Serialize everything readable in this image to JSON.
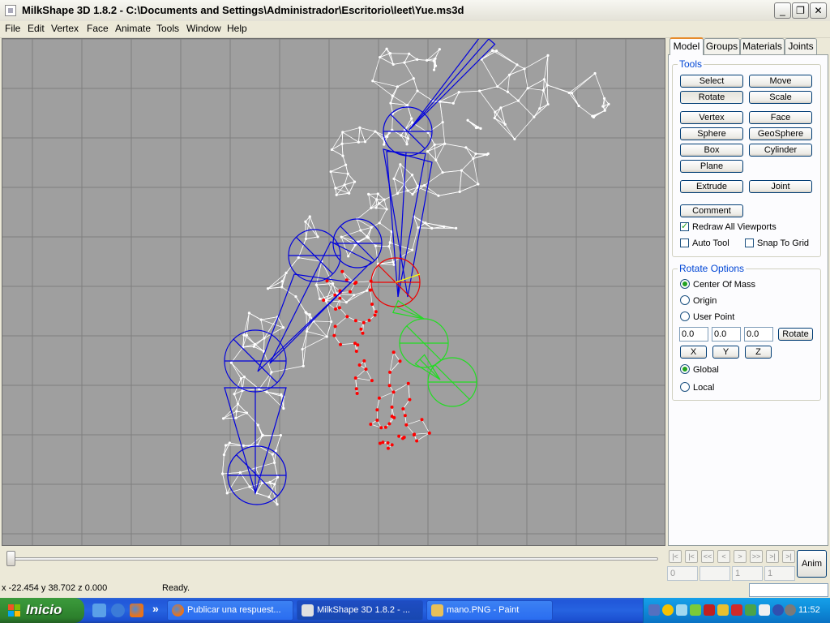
{
  "window": {
    "title": "MilkShape 3D 1.8.2 - C:\\Documents and Settings\\Administrador\\Escritorio\\leet\\Yue.ms3d",
    "minimize": "_",
    "maximize": "❐",
    "close": "✕"
  },
  "menu": [
    "File",
    "Edit",
    "Vertex",
    "Face",
    "Animate",
    "Tools",
    "Window",
    "Help"
  ],
  "tabs": [
    "Model",
    "Groups",
    "Materials",
    "Joints"
  ],
  "tools": {
    "legend": "Tools",
    "select": "Select",
    "move": "Move",
    "rotate": "Rotate",
    "scale": "Scale",
    "vertex": "Vertex",
    "face": "Face",
    "sphere": "Sphere",
    "geosphere": "GeoSphere",
    "box": "Box",
    "cylinder": "Cylinder",
    "plane": "Plane",
    "extrude": "Extrude",
    "joint": "Joint",
    "comment": "Comment",
    "redraw_all": "Redraw All Viewports",
    "auto_tool": "Auto Tool",
    "snap_to_grid": "Snap To Grid"
  },
  "rotate_options": {
    "legend": "Rotate Options",
    "center_of_mass": "Center Of Mass",
    "origin": "Origin",
    "user_point": "User Point",
    "x_value": "0.0",
    "y_value": "0.0",
    "z_value": "0.0",
    "rotate_btn": "Rotate",
    "x_btn": "X",
    "y_btn": "Y",
    "z_btn": "Z",
    "global": "Global",
    "local": "Local"
  },
  "timeline": {
    "frame_start": "0",
    "frame_current": "1",
    "frame_end": "1",
    "nav": [
      "|<",
      "|<",
      "<<",
      "<",
      ">",
      ">>",
      ">|",
      ">|"
    ],
    "anim": "Anim"
  },
  "status": {
    "coords": "x -22.454 y 38.702 z 0.000",
    "message": "Ready."
  },
  "taskbar": {
    "start": "Inicio",
    "quick_more": "»",
    "items": [
      "Publicar una respuest...",
      "MilkShape 3D 1.8.2 - ...",
      "mano.PNG - Paint"
    ],
    "clock": "11:52"
  },
  "colors": {
    "viewport_bg": "#9f9f9f",
    "grid": "#7f7f7f",
    "mesh": "#ffffff",
    "joint_blue": "#0000dd",
    "joint_selected": "#ee0000",
    "joint_green": "#22dd22",
    "selected_vertex": "#ff0000"
  }
}
